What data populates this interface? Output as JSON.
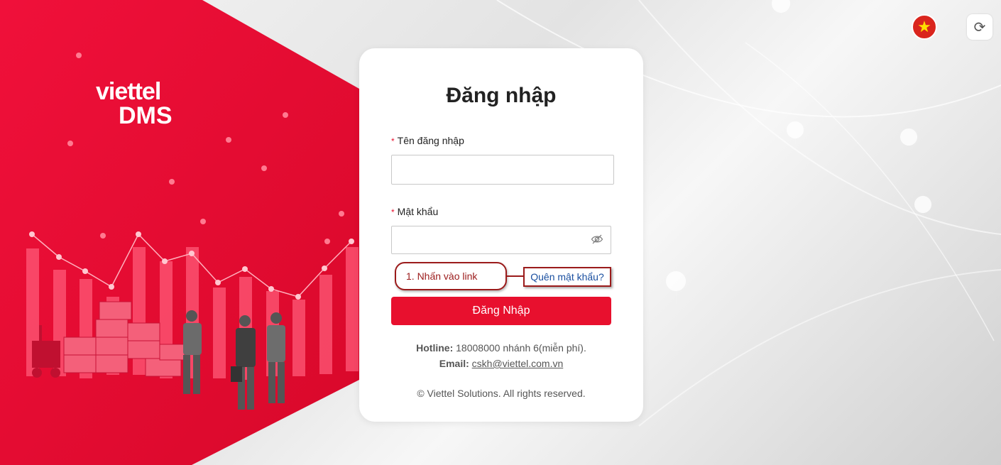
{
  "brand": {
    "logo_word": "viettel",
    "logo_product": "DMS",
    "primary_color": "#e8102e"
  },
  "topbar": {
    "language_flag": "vietnam-flag-icon",
    "refresh_icon": "refresh-icon"
  },
  "login": {
    "title": "Đăng nhập",
    "username_label": "Tên đăng nhập",
    "password_label": "Mật khẩu",
    "required_mark": "*",
    "username_value": "",
    "password_value": "",
    "forgot_link": "Quên mật khẩu?",
    "submit_label": "Đăng Nhập"
  },
  "annotation": {
    "callout_text": "1. Nhấn vào link",
    "highlight_color": "#9b1b1b"
  },
  "contact": {
    "hotline_label": "Hotline:",
    "hotline_value": "18008000 nhánh 6(miễn phí).",
    "email_label": "Email:",
    "email_value": "cskh@viettel.com.vn",
    "copyright": "© Viettel Solutions. All rights reserved."
  }
}
